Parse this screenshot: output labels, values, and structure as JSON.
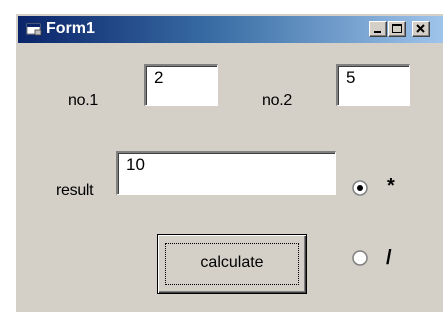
{
  "window": {
    "title": "Form1",
    "controls": {
      "minimize_icon": "minimize-icon",
      "maximize_icon": "maximize-icon",
      "close_icon": "close-icon"
    }
  },
  "form": {
    "no1": {
      "label": "no.1",
      "value": "2"
    },
    "no2": {
      "label": "no.2",
      "value": "5"
    },
    "result": {
      "label": "result",
      "value": "10"
    },
    "calculate_button": "calculate",
    "operations": [
      {
        "label": "*",
        "selected": true
      },
      {
        "label": "/",
        "selected": false
      }
    ]
  },
  "colors": {
    "face": "#d4d0c8",
    "title_start": "#0a246a",
    "title_end": "#a6caf0"
  }
}
